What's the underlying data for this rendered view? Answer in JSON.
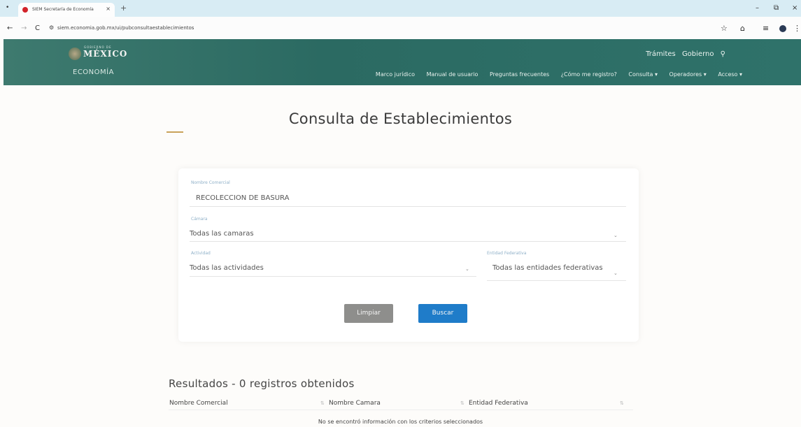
{
  "browser": {
    "tab_title": "SIEM Secretaría de Economía",
    "tab_close": "×",
    "new_tab": "+",
    "url": "siem.economia.gob.mx/ui/pubconsultaestablecimientos",
    "colors": {
      "tabstrip": "#d8ecf4"
    }
  },
  "header": {
    "logo_small": "GOBIERNO DE",
    "logo": "MÉXICO",
    "subsecretaria": "ECONOMÍA",
    "top_links": [
      "Trámites",
      "Gobierno"
    ],
    "nav": [
      "Marco jurídico",
      "Manual de usuario",
      "Preguntas frecuentes",
      "¿Cómo me registro?",
      "Consulta ▾",
      "Operadores ▾",
      "Acceso ▾"
    ],
    "colors": {
      "bar": "#2f6e66"
    }
  },
  "main": {
    "title": "Consulta de Establecimientos",
    "form": {
      "nombre_label": "Nombre Comercial",
      "nombre_value": "RECOLECCION DE BASURA",
      "camara_label": "Cámara",
      "camara_value": "Todas las camaras",
      "actividad_label": "Actividad",
      "actividad_value": "Todas las actividades",
      "entidad_label": "Entidad Federativa",
      "entidad_value": "Todas las entidades federativas",
      "clear_label": "Limpiar",
      "search_label": "Buscar",
      "colors": {
        "search": "#1f7cc9",
        "clear": "#8e8e8c"
      }
    },
    "results": {
      "title": "Resultados - 0 registros obtenidos",
      "columns": [
        "Nombre Comercial",
        "Nombre Camara",
        "Entidad Federativa"
      ],
      "empty_message": "No se encontró información con los criterios seleccionados"
    }
  }
}
